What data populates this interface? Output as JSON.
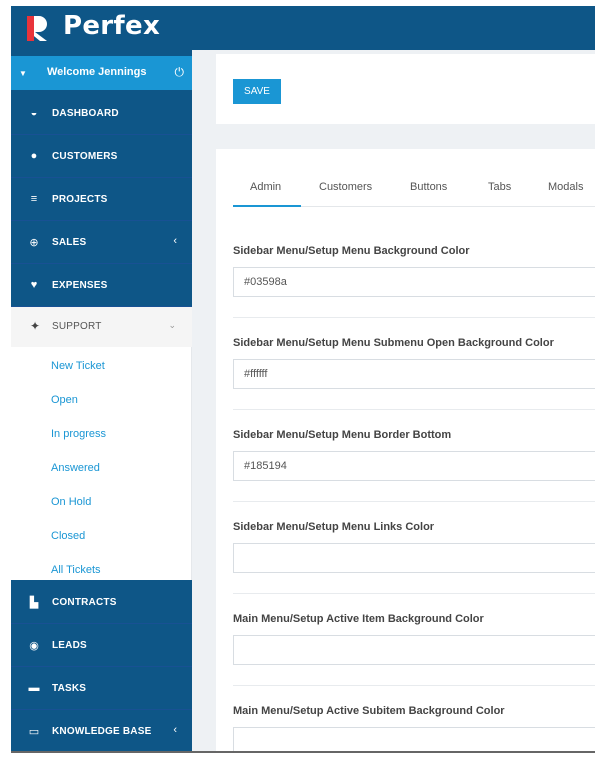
{
  "app": {
    "brand": "Perfex",
    "colors": {
      "sidebar": "#0e5687",
      "accent": "#1a96d4",
      "background": "#eef1f4"
    }
  },
  "sidebar": {
    "welcome": {
      "label": "Welcome Jennings",
      "icon": "power-icon"
    },
    "items": [
      {
        "label": "DASHBOARD",
        "icon": "dashboard-icon"
      },
      {
        "label": "CUSTOMERS",
        "icon": "users-icon"
      },
      {
        "label": "PROJECTS",
        "icon": "bars-icon"
      },
      {
        "label": "SALES",
        "icon": "globe-icon",
        "chevron": "‹"
      },
      {
        "label": "EXPENSES",
        "icon": "heart-icon"
      },
      {
        "label": "SUPPORT",
        "icon": "rocket-icon"
      },
      {
        "label": "CONTRACTS",
        "icon": "file-icon"
      },
      {
        "label": "LEADS",
        "icon": "tag-icon"
      },
      {
        "label": "TASKS",
        "icon": "tasks-icon"
      },
      {
        "label": "KNOWLEDGE BASE",
        "icon": "folder-icon",
        "chevron": "‹"
      }
    ],
    "support_submenu": [
      "New Ticket",
      "Open",
      "In progress",
      "Answered",
      "On Hold",
      "Closed",
      "All Tickets"
    ]
  },
  "toolbar": {
    "save_label": "SAVE"
  },
  "tabs": [
    "Admin",
    "Customers",
    "Buttons",
    "Tabs",
    "Modals"
  ],
  "fields": [
    {
      "label": "Sidebar Menu/Setup Menu Background Color",
      "value": "#03598a"
    },
    {
      "label": "Sidebar Menu/Setup Menu Submenu Open Background Color",
      "value": "#ffffff"
    },
    {
      "label": "Sidebar Menu/Setup Menu Border Bottom",
      "value": "#185194"
    },
    {
      "label": "Sidebar Menu/Setup Menu Links Color",
      "value": ""
    },
    {
      "label": "Main Menu/Setup Active Item Background Color",
      "value": ""
    },
    {
      "label": "Main Menu/Setup Active Subitem Background Color",
      "value": ""
    }
  ]
}
